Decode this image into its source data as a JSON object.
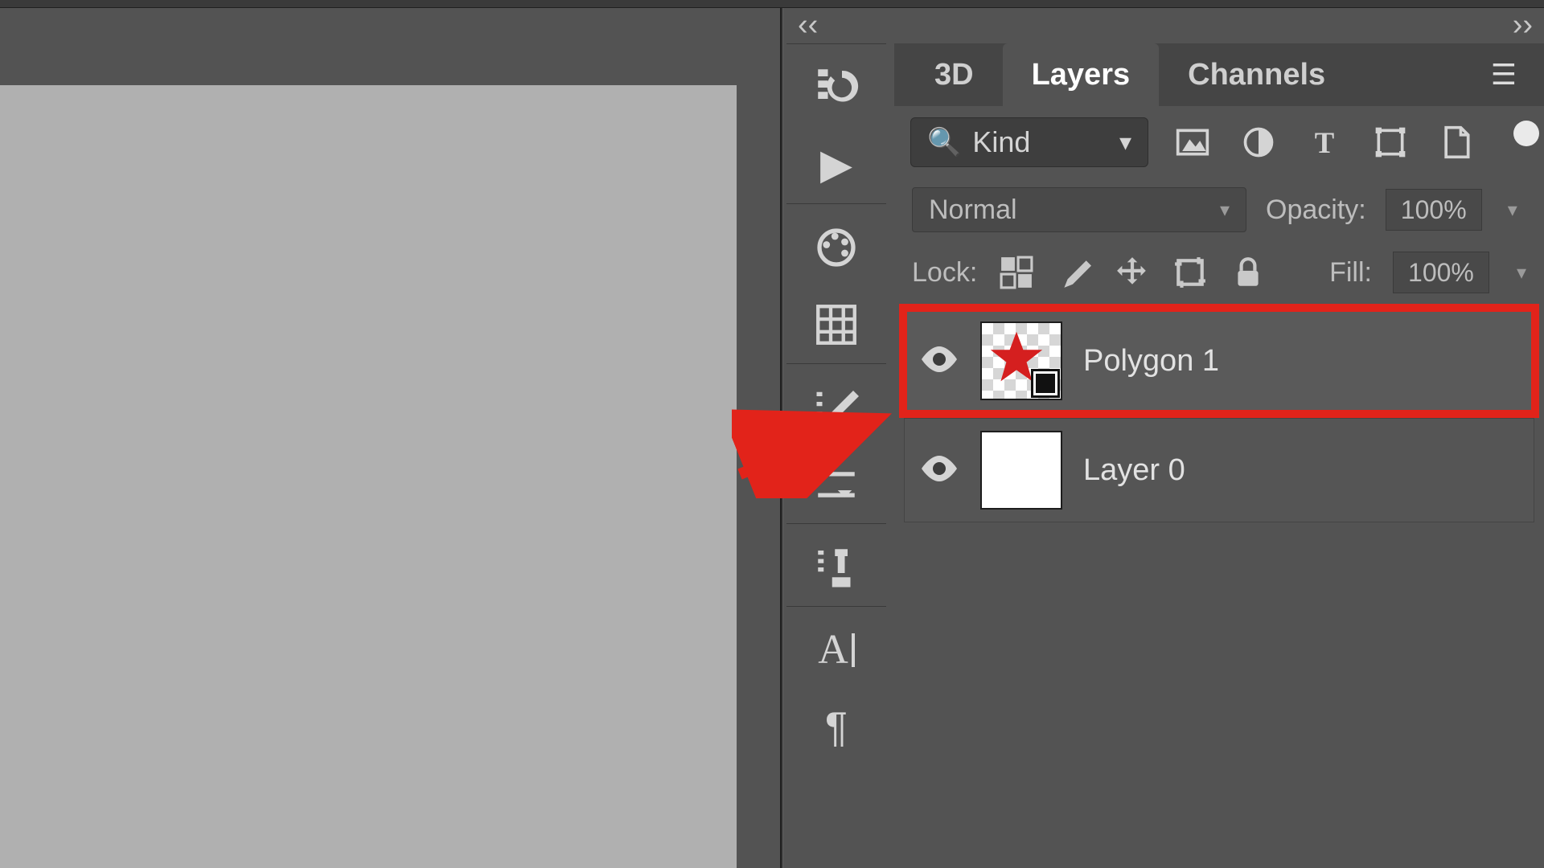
{
  "expander": {
    "collapse": "‹‹",
    "expand": "››"
  },
  "tabs": {
    "t3d": "3D",
    "layers": "Layers",
    "channels": "Channels"
  },
  "filter": {
    "kind": "Kind"
  },
  "blend": {
    "mode": "Normal",
    "opacity_label": "Opacity:",
    "opacity_value": "100%"
  },
  "lock": {
    "label": "Lock:",
    "fill_label": "Fill:",
    "fill_value": "100%"
  },
  "layers": {
    "items": [
      {
        "name": "Polygon 1",
        "visible": true,
        "thumb": "star",
        "highlighted": true
      },
      {
        "name": "Layer 0",
        "visible": true,
        "thumb": "blank",
        "highlighted": false
      }
    ]
  },
  "toolcol_groups": [
    "panels",
    "presets",
    "",
    "",
    "",
    "",
    ""
  ]
}
